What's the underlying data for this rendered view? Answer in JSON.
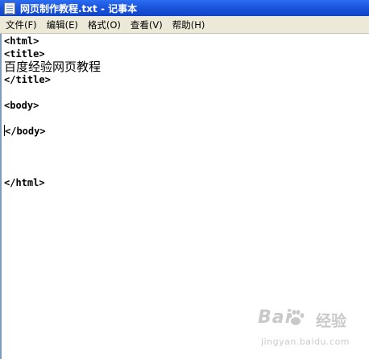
{
  "window": {
    "title": "网页制作教程.txt - 记事本"
  },
  "menu": [
    {
      "label": "文件(F)"
    },
    {
      "label": "编辑(E)"
    },
    {
      "label": "格式(O)"
    },
    {
      "label": "查看(V)"
    },
    {
      "label": "帮助(H)"
    }
  ],
  "editor": {
    "lines": [
      "<html>",
      "<title>",
      "百度经验网页教程",
      "</title>",
      "",
      "<body>",
      "",
      "</body>",
      "",
      "",
      "",
      "</html>"
    ]
  },
  "watermark": {
    "brand": "Bai",
    "product": "经验",
    "url": "jingyan.baidu.com"
  },
  "icons": {
    "app": "notepad-icon",
    "watermark": "paw-icon"
  }
}
